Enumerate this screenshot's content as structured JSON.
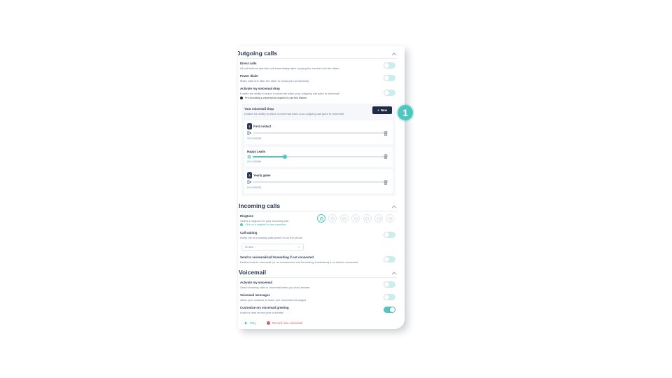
{
  "outgoing": {
    "title": "Outgoing calls",
    "direct_calls": {
      "title": "Direct calls",
      "desc": "All call buttons start the call immediately after copying the number into the dialer",
      "enabled": false
    },
    "power_dialer": {
      "title": "Power dialer",
      "desc": "Make calls one after the other to boost your productivity",
      "enabled": false
    },
    "voicemail_drop": {
      "title": "Activate my voicemail drop",
      "desc": "Enable the ability to leave a voicemail when your outgoing call goes to voicemail",
      "note": "Pre-recording a voicemail is required to use this feature",
      "enabled": false
    }
  },
  "drop_panel": {
    "title": "Your voicemail drop",
    "desc": "Enable the ability to leave a voicemail when your outgoing call goes to voicemail",
    "new_button": "New",
    "recordings": [
      {
        "badge": "1",
        "name": "First contact",
        "current": "00:00",
        "total": "00:50",
        "progress": 0,
        "playing": false
      },
      {
        "badge": "",
        "name": "Happy Leads",
        "current": "00:12",
        "total": "00:50",
        "progress": 0.24,
        "playing": true
      },
      {
        "badge": "2",
        "name": "Yearly game",
        "current": "00:00",
        "total": "00:50",
        "progress": 0,
        "playing": false
      }
    ]
  },
  "incoming": {
    "title": "Incoming calls",
    "ringtone": {
      "title": "Ringtone",
      "desc": "Select a ringtone for your incoming call",
      "note": "Click on a ringtone to hear a preview",
      "options_count": 7,
      "selected_index": 0
    },
    "call_waiting": {
      "title": "Call waiting",
      "desc": "Notify me of incoming calls when I'm on the phone",
      "enabled": false,
      "select_value": "30 sec"
    },
    "forwarding": {
      "title": "Send to voicemail/call forwarding if not connected",
      "desc": "Redirect call to voicemail (or on unanswered call forwarding if activated) if no device connected",
      "enabled": false
    }
  },
  "voicemail": {
    "title": "Voicemail",
    "activate": {
      "title": "Activate my voicemail",
      "desc": "Send incoming calls to voicemail when you don't answer",
      "enabled": false
    },
    "messages": {
      "title": "Voicemail messages",
      "desc": "Allow your contacts to leave you voicemail messages",
      "enabled": false
    },
    "greeting": {
      "title": "Customize my voicemail greeting",
      "desc": "Listen to and record your voicemail",
      "enabled": true
    },
    "play_label": "Play",
    "record_label": "Record new voicemail"
  },
  "callout": {
    "number": "1"
  },
  "colors": {
    "accent": "#4fc6bf",
    "dark": "#1f2a44",
    "danger": "#e0566c"
  }
}
